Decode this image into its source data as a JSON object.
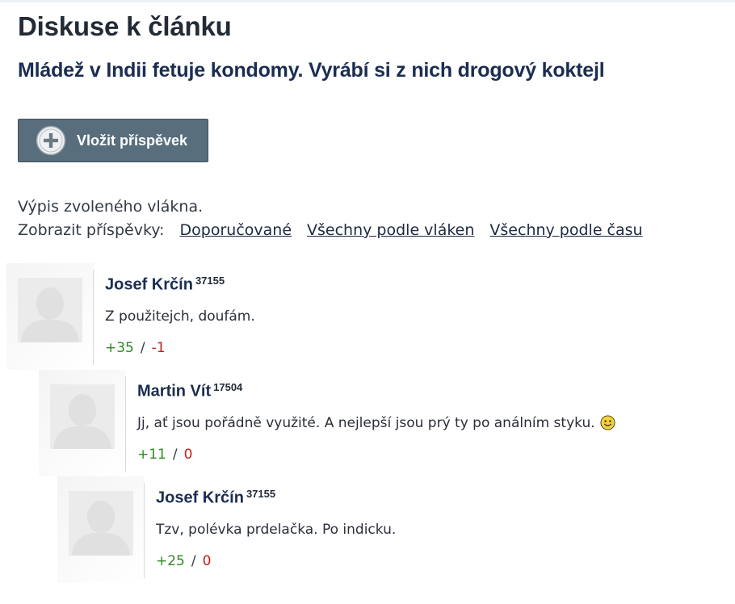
{
  "page": {
    "title": "Diskuse k článku",
    "article_title": "Mládež v Indii fetuje kondomy. Vyrábí si z nich drogový koktejl"
  },
  "actions": {
    "add_post_label": "Vložit příspěvek",
    "add_post_icon": "plus-circle-icon"
  },
  "thread": {
    "note": "Výpis zvoleného vlákna.",
    "show_label": "Zobrazit příspěvky:",
    "filters": [
      "Doporučované",
      "Všechny podle vláken",
      "Všechny podle času"
    ]
  },
  "comments": [
    {
      "author": "Josef Krčín",
      "karma": "37155",
      "text": "Z použitejch, doufám.",
      "upvotes": "+35",
      "downvotes": "-1"
    },
    {
      "author": "Martin Vít",
      "karma": "17504",
      "text": "Jj, ať jsou pořádně využité. A nejlepší jsou prý ty po análním styku.",
      "emoticon": "smiley-icon",
      "upvotes": "+11",
      "downvotes": "0"
    },
    {
      "author": "Josef Krčín",
      "karma": "37155",
      "text": "Tzv, polévka prdelačka. Po indicku.",
      "upvotes": "+25",
      "downvotes": "0"
    }
  ],
  "colors": {
    "button_bg": "#586e7d",
    "title": "#1b2d52",
    "upvote": "#2d8a1f",
    "downvote": "#c41d1d"
  }
}
